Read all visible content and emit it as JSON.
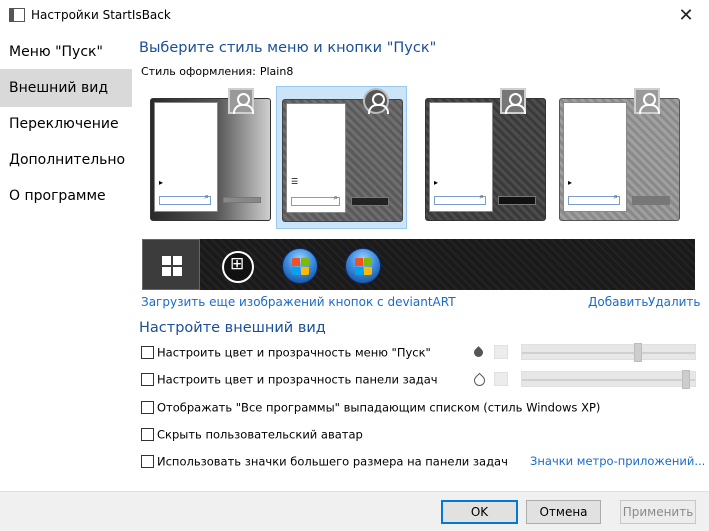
{
  "window": {
    "title": "Настройки StartIsBack",
    "close_glyph": "✕"
  },
  "sidebar": {
    "items": [
      {
        "label": "Меню \"Пуск\"",
        "active": false
      },
      {
        "label": "Внешний вид",
        "active": true
      },
      {
        "label": "Переключение",
        "active": false
      },
      {
        "label": "Дополнительно",
        "active": false
      },
      {
        "label": "О программе",
        "active": false
      }
    ]
  },
  "main": {
    "style_heading": "Выберите стиль меню и кнопки \"Пуск\"",
    "style_label": "Стиль оформления:",
    "style_value": "Plain8",
    "links": {
      "download": "Загрузить еще изображений кнопок с deviantART",
      "add": "Добавить",
      "remove": "Удалить",
      "metro": "Значки метро-приложений..."
    },
    "appearance_heading": "Настройте внешний вид",
    "options": [
      {
        "label": "Настроить цвет и прозрачность меню \"Пуск\"",
        "checked": false
      },
      {
        "label": "Настроить цвет и прозрачность панели задач",
        "checked": false
      },
      {
        "label": "Отображать \"Все программы\" выпадающим списком (стиль Windows XP)",
        "checked": false
      },
      {
        "label": "Скрыть пользовательский аватар",
        "checked": false
      },
      {
        "label": "Использовать значки большего размера на панели задач",
        "checked": false
      }
    ],
    "sliders": {
      "menu_transparency": 0.68,
      "taskbar_transparency": 0.97
    }
  },
  "footer": {
    "ok": "OK",
    "cancel": "Отмена",
    "apply": "Применить"
  },
  "colors": {
    "accent": "#0078d7",
    "heading": "#1b4f9a",
    "link": "#1b6ac9",
    "selected_bg": "#cce4f7",
    "nav_active": "#d9d9d9"
  }
}
